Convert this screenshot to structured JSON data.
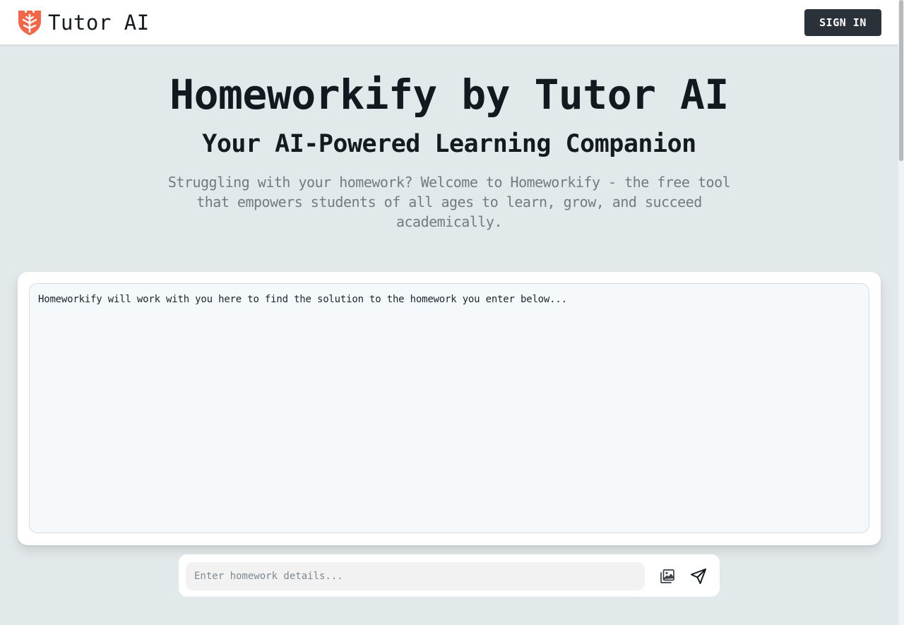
{
  "header": {
    "brand_name": "Tutor AI",
    "logo_icon": "shield-logo-icon",
    "signin_label": "SIGN IN"
  },
  "hero": {
    "title": "Homeworkify by Tutor AI",
    "subtitle": "Your AI-Powered Learning Companion",
    "description": "Struggling with your homework? Welcome to Homeworkify - the free tool that empowers students of all ages to learn, grow, and succeed academically."
  },
  "chat": {
    "intro_message": "Homeworkify will work with you here to find the solution to the homework you enter below..."
  },
  "composer": {
    "placeholder": "Enter homework details...",
    "value": "",
    "image_icon": "image-upload-icon",
    "send_icon": "send-icon"
  },
  "colors": {
    "brand_accent": "#f26546",
    "page_background": "#e2e9eb",
    "button_dark": "#2b3138",
    "muted_text": "#737b80"
  }
}
